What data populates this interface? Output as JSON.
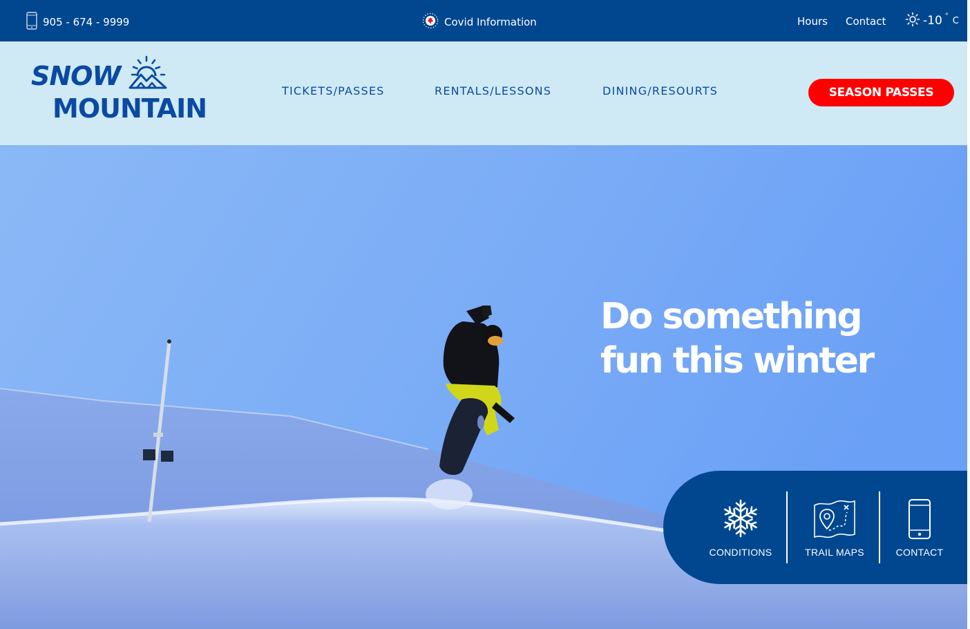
{
  "topbar": {
    "phone": "905 - 674 - 9999",
    "covid": "Covid Information",
    "hours": "Hours",
    "contact": "Contact",
    "weather": {
      "temp": "-10",
      "deg": "°",
      "unit": "C",
      "icon": "sun-icon"
    }
  },
  "logo": {
    "line1": "SNOW",
    "line2": "MOUNTAIN"
  },
  "nav": {
    "items": [
      "TICKETS/PASSES",
      "RENTALS/LESSONS",
      "DINING/RESOURTS"
    ],
    "cta": "SEASON PASSES"
  },
  "hero": {
    "line1": "Do something",
    "line2": "fun this winter"
  },
  "quick_links": [
    {
      "label": "CONDITIONS",
      "icon": "snowflake-icon"
    },
    {
      "label": "TRAIL MAPS",
      "icon": "map-icon"
    },
    {
      "label": "CONTACT",
      "icon": "mobile-phone-icon"
    }
  ],
  "colors": {
    "brand_blue": "#01478f",
    "logo_blue": "#0b4aa2",
    "header_bg": "#cfeaf5",
    "cta_red": "#ff0000",
    "sky": "#6fa6f5"
  }
}
